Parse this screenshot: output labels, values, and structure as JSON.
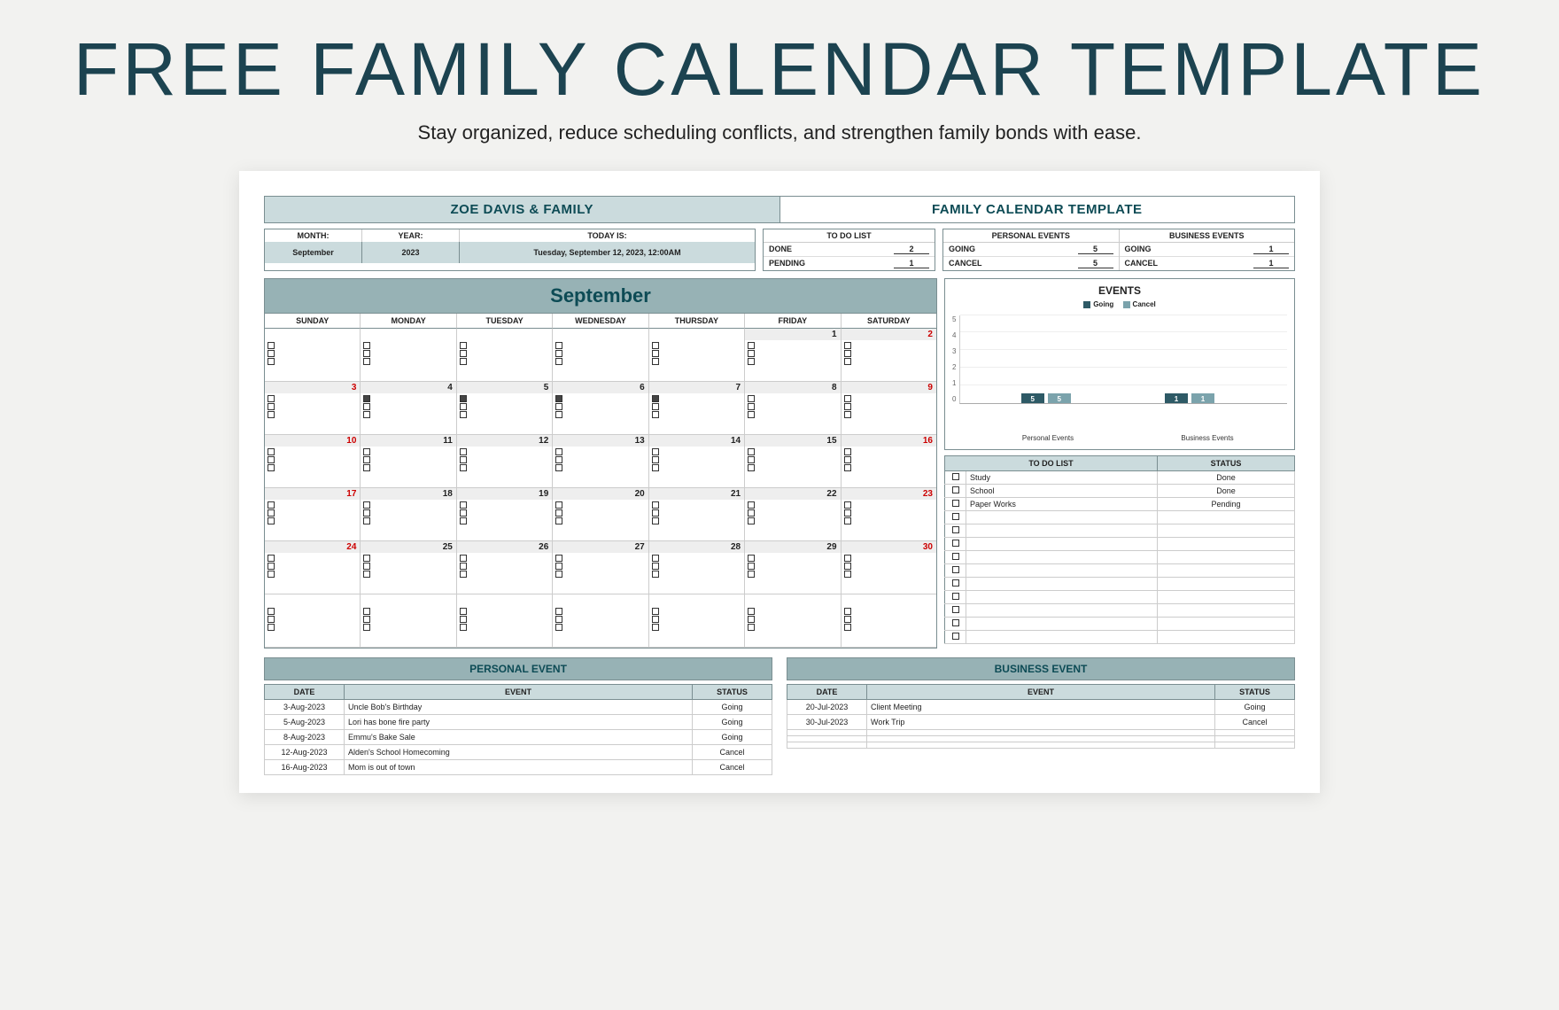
{
  "page": {
    "title": "FREE FAMILY CALENDAR TEMPLATE",
    "subtitle": "Stay organized, reduce scheduling conflicts, and strengthen family bonds with ease."
  },
  "header": {
    "left": "ZOE DAVIS & FAMILY",
    "right": "FAMILY CALENDAR TEMPLATE"
  },
  "meta": {
    "labels": {
      "month": "MONTH:",
      "year": "YEAR:",
      "today": "TODAY IS:"
    },
    "month": "September",
    "year": "2023",
    "today": "Tuesday, September 12, 2023, 12:00AM"
  },
  "todo_summary": {
    "title": "TO DO LIST",
    "rows": [
      {
        "label": "DONE",
        "value": "2"
      },
      {
        "label": "PENDING",
        "value": "1"
      }
    ]
  },
  "personal_summary": {
    "title": "PERSONAL EVENTS",
    "rows": [
      {
        "label": "GOING",
        "value": "5"
      },
      {
        "label": "CANCEL",
        "value": "5"
      }
    ]
  },
  "business_summary": {
    "title": "BUSINESS EVENTS",
    "rows": [
      {
        "label": "GOING",
        "value": "1"
      },
      {
        "label": "CANCEL",
        "value": "1"
      }
    ]
  },
  "calendar": {
    "month_title": "September",
    "days": [
      "SUNDAY",
      "MONDAY",
      "TUESDAY",
      "WEDNESDAY",
      "THURSDAY",
      "FRIDAY",
      "SATURDAY"
    ],
    "weeks": [
      [
        {
          "n": "",
          "we": false,
          "oth": true
        },
        {
          "n": "",
          "we": false,
          "oth": true
        },
        {
          "n": "",
          "we": false,
          "oth": true
        },
        {
          "n": "",
          "we": false,
          "oth": true
        },
        {
          "n": "",
          "we": false,
          "oth": true
        },
        {
          "n": "1",
          "we": false
        },
        {
          "n": "2",
          "we": true
        }
      ],
      [
        {
          "n": "3",
          "we": true
        },
        {
          "n": "4",
          "we": false,
          "chk": true
        },
        {
          "n": "5",
          "we": false,
          "chk": true
        },
        {
          "n": "6",
          "we": false,
          "chk": true
        },
        {
          "n": "7",
          "we": false,
          "chk": true
        },
        {
          "n": "8",
          "we": false
        },
        {
          "n": "9",
          "we": true
        }
      ],
      [
        {
          "n": "10",
          "we": true
        },
        {
          "n": "11",
          "we": false
        },
        {
          "n": "12",
          "we": false
        },
        {
          "n": "13",
          "we": false
        },
        {
          "n": "14",
          "we": false
        },
        {
          "n": "15",
          "we": false
        },
        {
          "n": "16",
          "we": true
        }
      ],
      [
        {
          "n": "17",
          "we": true
        },
        {
          "n": "18",
          "we": false
        },
        {
          "n": "19",
          "we": false
        },
        {
          "n": "20",
          "we": false
        },
        {
          "n": "21",
          "we": false
        },
        {
          "n": "22",
          "we": false
        },
        {
          "n": "23",
          "we": true
        }
      ],
      [
        {
          "n": "24",
          "we": true
        },
        {
          "n": "25",
          "we": false
        },
        {
          "n": "26",
          "we": false
        },
        {
          "n": "27",
          "we": false
        },
        {
          "n": "28",
          "we": false
        },
        {
          "n": "29",
          "we": false
        },
        {
          "n": "30",
          "we": true
        }
      ],
      [
        {
          "n": "",
          "we": false,
          "oth": true
        },
        {
          "n": "",
          "we": false,
          "oth": true
        },
        {
          "n": "",
          "we": false,
          "oth": true
        },
        {
          "n": "",
          "we": false,
          "oth": true
        },
        {
          "n": "",
          "we": false,
          "oth": true
        },
        {
          "n": "",
          "we": false,
          "oth": true
        },
        {
          "n": "",
          "we": false,
          "oth": true
        }
      ]
    ]
  },
  "chart_data": {
    "type": "bar",
    "title": "EVENTS",
    "legend": [
      "Going",
      "Cancel"
    ],
    "categories": [
      "Personal Events",
      "Business Events"
    ],
    "series": [
      {
        "name": "Going",
        "values": [
          5,
          1
        ]
      },
      {
        "name": "Cancel",
        "values": [
          5,
          1
        ]
      }
    ],
    "ylim": [
      0,
      5
    ],
    "yticks": [
      0,
      1,
      2,
      3,
      4,
      5
    ],
    "colors": {
      "Going": "#2e5a66",
      "Cancel": "#7ba3ac"
    }
  },
  "todolist": {
    "headers": [
      "TO DO LIST",
      "STATUS"
    ],
    "rows": [
      {
        "task": "Study",
        "status": "Done"
      },
      {
        "task": "School",
        "status": "Done"
      },
      {
        "task": "Paper Works",
        "status": "Pending"
      },
      {
        "task": "",
        "status": ""
      },
      {
        "task": "",
        "status": ""
      },
      {
        "task": "",
        "status": ""
      },
      {
        "task": "",
        "status": ""
      },
      {
        "task": "",
        "status": ""
      },
      {
        "task": "",
        "status": ""
      },
      {
        "task": "",
        "status": ""
      },
      {
        "task": "",
        "status": ""
      },
      {
        "task": "",
        "status": ""
      },
      {
        "task": "",
        "status": ""
      }
    ]
  },
  "personal_events": {
    "title": "PERSONAL EVENT",
    "headers": [
      "DATE",
      "EVENT",
      "STATUS"
    ],
    "rows": [
      {
        "date": "3-Aug-2023",
        "event": "Uncle Bob's Birthday",
        "status": "Going"
      },
      {
        "date": "5-Aug-2023",
        "event": "Lori has bone fire party",
        "status": "Going"
      },
      {
        "date": "8-Aug-2023",
        "event": "Emmu's Bake Sale",
        "status": "Going"
      },
      {
        "date": "12-Aug-2023",
        "event": "Alden's School Homecoming",
        "status": "Cancel"
      },
      {
        "date": "16-Aug-2023",
        "event": "Mom is out of town",
        "status": "Cancel"
      }
    ]
  },
  "business_events": {
    "title": "BUSINESS EVENT",
    "headers": [
      "DATE",
      "EVENT",
      "STATUS"
    ],
    "rows": [
      {
        "date": "20-Jul-2023",
        "event": "Client Meeting",
        "status": "Going"
      },
      {
        "date": "30-Jul-2023",
        "event": "Work Trip",
        "status": "Cancel"
      },
      {
        "date": "",
        "event": "",
        "status": ""
      },
      {
        "date": "",
        "event": "",
        "status": ""
      },
      {
        "date": "",
        "event": "",
        "status": ""
      }
    ]
  }
}
